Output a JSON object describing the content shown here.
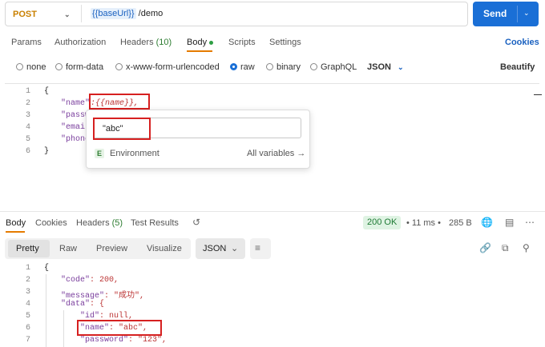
{
  "request": {
    "method": "POST",
    "url_var": "{{baseUrl}}",
    "url_path": " /demo",
    "send_label": "Send"
  },
  "request_tabs": [
    {
      "label": "Params"
    },
    {
      "label": "Authorization"
    },
    {
      "label": "Headers",
      "count": "(10)"
    },
    {
      "label": "Body"
    },
    {
      "label": "Scripts"
    },
    {
      "label": "Settings"
    }
  ],
  "cookies_label": "Cookies",
  "body_types": [
    "none",
    "form-data",
    "x-www-form-urlencoded",
    "raw",
    "binary",
    "GraphQL"
  ],
  "body_format": "JSON",
  "beautify_label": "Beautify",
  "editor": {
    "line_numbers": [
      "1",
      "2",
      "3",
      "4",
      "5",
      "6"
    ],
    "open_brace": "{",
    "close_brace": "}",
    "name_key": "\"name\"",
    "name_value": ":{{name}},",
    "partial_keys": [
      "\"passw",
      "\"email",
      "\"phone"
    ]
  },
  "autocomplete": {
    "input_value": "\"abc\"",
    "env_badge": "E",
    "env_label": "Environment",
    "all_vars": "All variables →"
  },
  "response_tabs": [
    {
      "label": "Body"
    },
    {
      "label": "Cookies"
    },
    {
      "label": "Headers",
      "count": "(5)"
    },
    {
      "label": "Test Results"
    }
  ],
  "response_meta": {
    "status": "200 OK",
    "time": "11 ms",
    "size": "285 B"
  },
  "view_modes": [
    "Pretty",
    "Raw",
    "Preview",
    "Visualize"
  ],
  "response_format": "JSON",
  "response_lines": [
    {
      "n": "1",
      "text": "{"
    },
    {
      "n": "2",
      "key": "\"code\"",
      "rest": ": 200,"
    },
    {
      "n": "3",
      "key": "\"message\"",
      "rest": ": \"成功\","
    },
    {
      "n": "4",
      "key": "\"data\"",
      "rest": ": {"
    },
    {
      "n": "5",
      "key": "\"id\"",
      "rest": ": null,"
    },
    {
      "n": "6",
      "key": "\"name\"",
      "rest": ": \"abc\","
    },
    {
      "n": "7",
      "key": "\"password\"",
      "rest": ": \"123\","
    }
  ],
  "colors": {
    "accent": "#1a6fd6",
    "highlight": "#d62020",
    "status_ok": "#1e7a34"
  }
}
